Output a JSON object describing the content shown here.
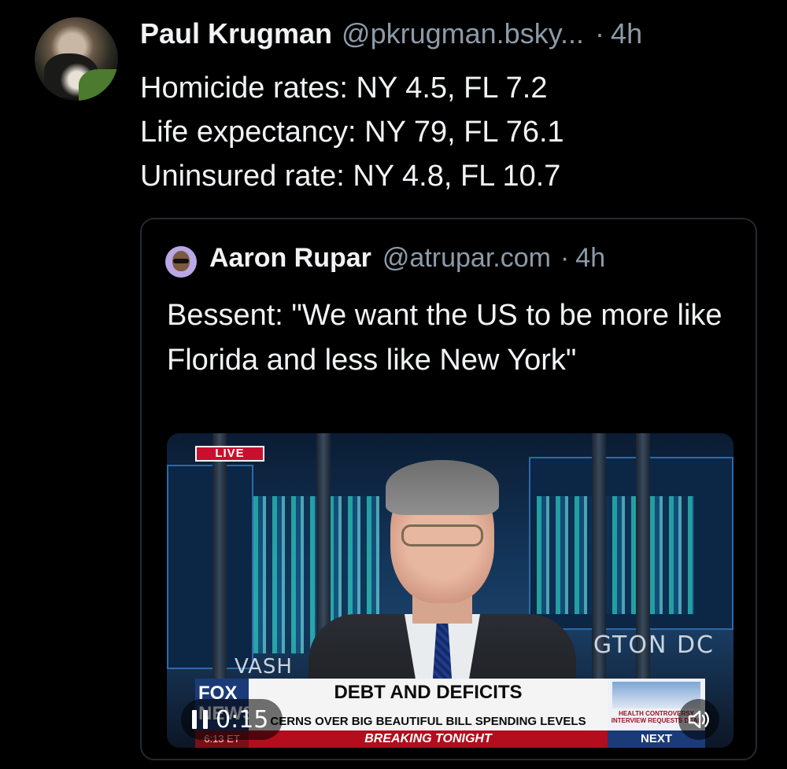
{
  "post": {
    "author_name": "Paul Krugman",
    "author_handle": "@pkrugman.bsky...",
    "separator": "·",
    "time": "4h",
    "lines": [
      "Homicide rates: NY 4.5, FL 7.2",
      "Life expectancy: NY 79, FL 76.1",
      "Uninsured rate: NY 4.8, FL 10.7"
    ]
  },
  "quote": {
    "author_name": "Aaron Rupar",
    "author_handle": "@atrupar.com",
    "separator": "·",
    "time": "4h",
    "text": "Bessent: \"We want the US to be more like Florida and less like New York\""
  },
  "video": {
    "live_label": "LIVE",
    "location_right": "GTON DC",
    "location_left": "VASH",
    "chyron_title": "DEBT AND DEFICITS",
    "chyron_subtitle": "CERNS OVER BIG BEAUTIFUL BILL SPENDING LEVELS",
    "breaking_label": "BREAKING TONIGHT",
    "network_logo": "FOX NEWS",
    "clock": "6:13 ET",
    "next_teaser": "HEALTH CONTROVERSY INTERVIEW REQUESTS DEAL",
    "next_label": "NEXT",
    "duration": "0:15"
  },
  "icons": {
    "pause": "pause-icon",
    "volume": "volume-icon"
  }
}
